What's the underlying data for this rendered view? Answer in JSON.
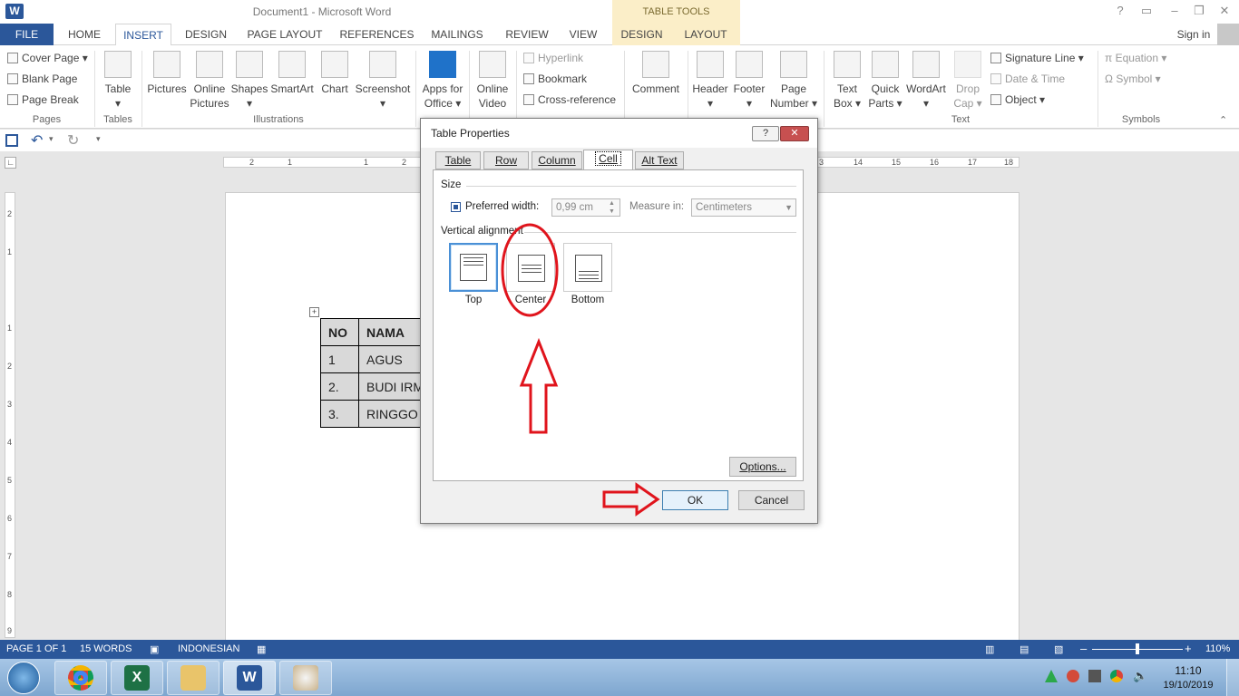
{
  "window": {
    "title": "Document1 - Microsoft Word",
    "table_tools": "TABLE TOOLS",
    "help": "?",
    "signin": "Sign in"
  },
  "tabs": [
    "FILE",
    "HOME",
    "INSERT",
    "DESIGN",
    "PAGE LAYOUT",
    "REFERENCES",
    "MAILINGS",
    "REVIEW",
    "VIEW",
    "DESIGN",
    "LAYOUT"
  ],
  "ribbon": {
    "pages": {
      "cover_page": "Cover Page",
      "blank_page": "Blank Page",
      "page_break": "Page Break",
      "label": "Pages"
    },
    "tables": {
      "table": "Table",
      "label": "Tables"
    },
    "illustrations": {
      "pictures": "Pictures",
      "online_pictures_1": "Online",
      "online_pictures_2": "Pictures",
      "shapes": "Shapes",
      "smartart": "SmartArt",
      "chart": "Chart",
      "screenshot": "Screenshot",
      "label": "Illustrations"
    },
    "apps": {
      "apps_1": "Apps for",
      "apps_2": "Office"
    },
    "media": {
      "video_1": "Online",
      "video_2": "Video"
    },
    "links": {
      "hyperlink": "Hyperlink",
      "bookmark": "Bookmark",
      "crossref": "Cross-reference"
    },
    "comments": {
      "comment": "Comment"
    },
    "header_footer": {
      "header": "Header",
      "footer": "Footer",
      "page_number_1": "Page",
      "page_number_2": "Number"
    },
    "text": {
      "textbox_1": "Text",
      "textbox_2": "Box",
      "quickparts_1": "Quick",
      "quickparts_2": "Parts",
      "wordart": "WordArt",
      "dropcap_1": "Drop",
      "dropcap_2": "Cap",
      "signature": "Signature Line",
      "datetime": "Date & Time",
      "object": "Object",
      "label": "Text"
    },
    "symbols": {
      "equation": "Equation",
      "symbol": "Symbol",
      "label": "Symbols"
    }
  },
  "ruler": {
    "h": [
      "2",
      "1",
      "1",
      "2",
      "3",
      "14",
      "15",
      "16",
      "17",
      "18"
    ],
    "v": [
      "2",
      "1",
      "1",
      "2",
      "3",
      "4",
      "5",
      "6",
      "7",
      "8",
      "9"
    ]
  },
  "doc_table": {
    "headers": [
      "NO",
      "NAMA"
    ],
    "rows": [
      [
        "1",
        "AGUS"
      ],
      [
        "2.",
        "BUDI IRM"
      ],
      [
        "3.",
        "RINGGO"
      ]
    ]
  },
  "dialog": {
    "title": "Table Properties",
    "help": "?",
    "close": "✕",
    "tabs": [
      "Table",
      "Row",
      "Column",
      "Cell",
      "Alt Text"
    ],
    "size_label": "Size",
    "preferred_width": "Preferred width:",
    "width_value": "0,99 cm",
    "measure_in": "Measure in:",
    "measure_value": "Centimeters",
    "valign_label": "Vertical alignment",
    "options": [
      "Top",
      "Center",
      "Bottom"
    ],
    "options_btn": "Options...",
    "ok": "OK",
    "cancel": "Cancel"
  },
  "status": {
    "page": "PAGE 1 OF 1",
    "words": "15 WORDS",
    "language": "INDONESIAN",
    "zoom": "110%"
  },
  "taskbar": {
    "time": "11:10",
    "date": "19/10/2019"
  },
  "colors": {
    "word_blue": "#2b579a",
    "annotation_red": "#e0141c",
    "table_tools": "#fbeec8"
  }
}
